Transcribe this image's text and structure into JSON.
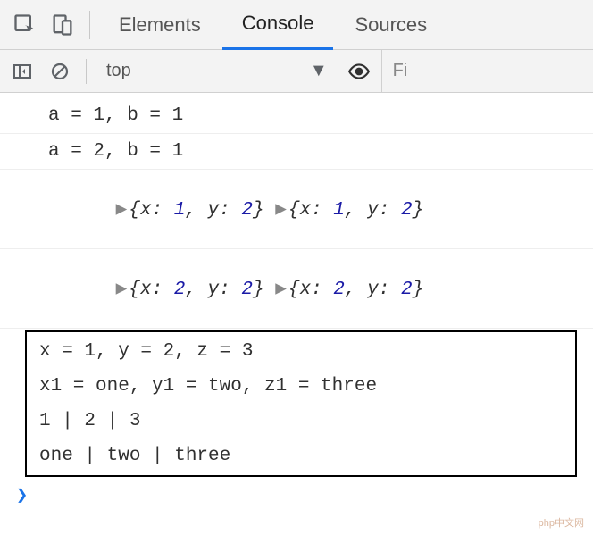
{
  "tabs": {
    "elements": "Elements",
    "console": "Console",
    "sources": "Sources",
    "active": "console"
  },
  "toolbar": {
    "context": "top",
    "filter_placeholder": "Fi"
  },
  "logs": {
    "l0": "a = 1, b = 1",
    "l1": "a = 2, b = 1",
    "obj0": {
      "x0": "x",
      "v0": "1",
      "y0": "y",
      "v1": "2",
      "x1": "x",
      "v2": "1",
      "y1": "y",
      "v3": "2"
    },
    "obj1": {
      "x0": "x",
      "v0": "2",
      "y0": "y",
      "v1": "2",
      "x1": "x",
      "v2": "2",
      "y1": "y",
      "v3": "2"
    },
    "b0": "x = 1, y = 2, z = 3",
    "b1": "x1 = one, y1 = two, z1 = three",
    "b2": "1 | 2 | 3",
    "b3": "one | two | three"
  },
  "prompt": ">",
  "watermark": "php中文网"
}
